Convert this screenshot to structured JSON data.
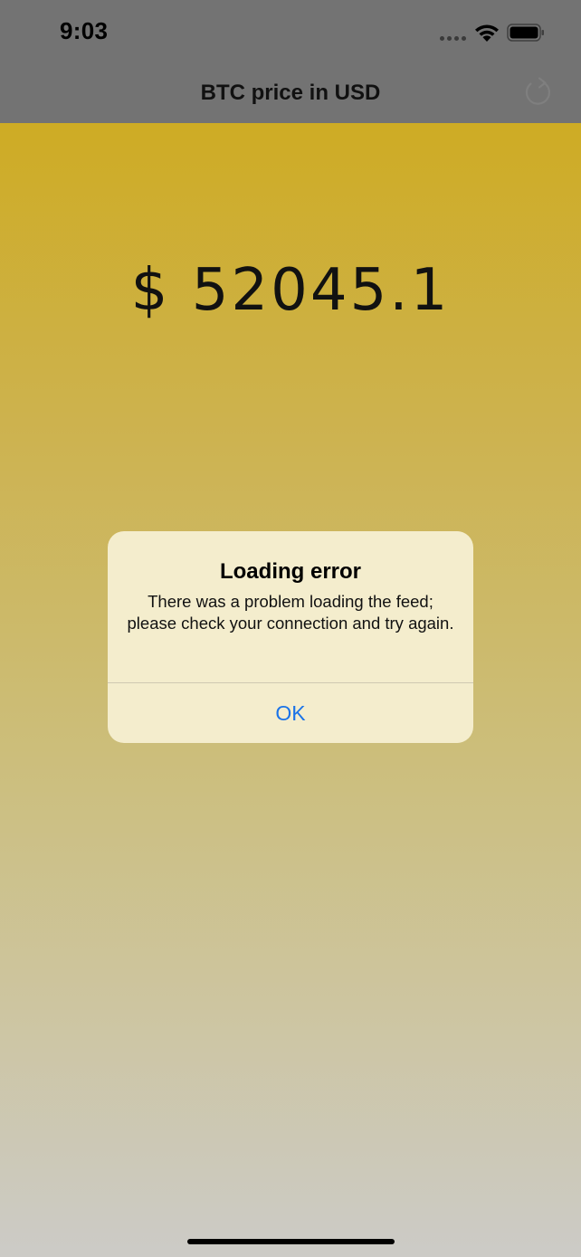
{
  "status_bar": {
    "time": "9:03",
    "signal_icon": "signal-dots-icon",
    "wifi_icon": "wifi-icon",
    "battery_icon": "battery-icon"
  },
  "nav": {
    "title": "BTC price in USD",
    "refresh_icon": "refresh-icon"
  },
  "main": {
    "price": "$ 52045.1"
  },
  "alert": {
    "title": "Loading error",
    "message": "There was a problem loading the feed; please check your connection and try again.",
    "ok_label": "OK",
    "accent_color": "#1a73e8"
  },
  "colors": {
    "nav_background": "#737373",
    "gradient_top": "#cea913",
    "gradient_bottom": "#cccbc7",
    "alert_background": "#f4edcd"
  }
}
